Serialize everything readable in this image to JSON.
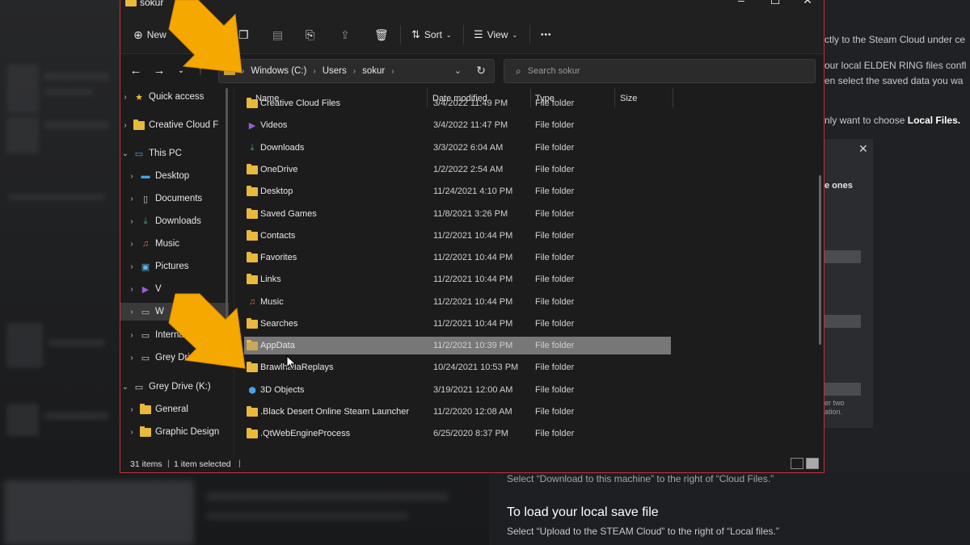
{
  "window": {
    "title": "sokur",
    "controls": [
      "–",
      "☐",
      "✕"
    ]
  },
  "toolbar": {
    "new_label": "New",
    "sort_label": "Sort",
    "view_label": "View",
    "more_label": "•••"
  },
  "address": {
    "segments": [
      "Windows (C:)",
      "Users",
      "sokur"
    ],
    "separator": "›",
    "search_placeholder": "Search sokur"
  },
  "sidebar": {
    "items": [
      {
        "label": "Quick access",
        "icon": "star-icon"
      },
      {
        "label": "Creative Cloud F",
        "icon": "folder-icon"
      },
      {
        "label": "This PC",
        "icon": "monitor-icon"
      },
      {
        "label": "Desktop",
        "icon": "desktop-icon"
      },
      {
        "label": "Documents",
        "icon": "documents-icon"
      },
      {
        "label": "Downloads",
        "icon": "download-icon"
      },
      {
        "label": "Music",
        "icon": "music-icon"
      },
      {
        "label": "Pictures",
        "icon": "pictures-icon"
      },
      {
        "label": "V",
        "icon": "videos-icon"
      },
      {
        "label": "W",
        "icon": "drive-icon"
      },
      {
        "label": "Internal",
        "icon": "drive-icon"
      },
      {
        "label": "Grey Drive (K:)",
        "icon": "drive-icon"
      },
      {
        "label": "Grey Drive (K:)",
        "icon": "drive-icon"
      },
      {
        "label": "General",
        "icon": "folder-icon"
      },
      {
        "label": "Graphic Design",
        "icon": "folder-icon"
      }
    ]
  },
  "columns": {
    "name": "Name",
    "date": "Date modified",
    "type": "Type",
    "size": "Size"
  },
  "files": [
    {
      "name": "Creative Cloud Files",
      "date": "3/4/2022 11:49 PM",
      "type": "File folder",
      "icon": "cloud-folder-icon"
    },
    {
      "name": "Videos",
      "date": "3/4/2022 11:47 PM",
      "type": "File folder",
      "icon": "videos-icon"
    },
    {
      "name": "Downloads",
      "date": "3/3/2022 6:04 AM",
      "type": "File folder",
      "icon": "download-icon"
    },
    {
      "name": "OneDrive",
      "date": "1/2/2022 2:54 AM",
      "type": "File folder",
      "icon": "folder-icon"
    },
    {
      "name": "Desktop",
      "date": "11/24/2021 4:10 PM",
      "type": "File folder",
      "icon": "folder-icon"
    },
    {
      "name": "Saved Games",
      "date": "11/8/2021 3:26 PM",
      "type": "File folder",
      "icon": "folder-icon"
    },
    {
      "name": "Contacts",
      "date": "11/2/2021 10:44 PM",
      "type": "File folder",
      "icon": "folder-icon"
    },
    {
      "name": "Favorites",
      "date": "11/2/2021 10:44 PM",
      "type": "File folder",
      "icon": "folder-icon"
    },
    {
      "name": "Links",
      "date": "11/2/2021 10:44 PM",
      "type": "File folder",
      "icon": "folder-icon"
    },
    {
      "name": "Music",
      "date": "11/2/2021 10:44 PM",
      "type": "File folder",
      "icon": "music-icon"
    },
    {
      "name": "Searches",
      "date": "11/2/2021 10:44 PM",
      "type": "File folder",
      "icon": "folder-icon"
    },
    {
      "name": "AppData",
      "date": "11/2/2021 10:39 PM",
      "type": "File folder",
      "icon": "folder-icon",
      "selected": true
    },
    {
      "name": "BrawlhallaReplays",
      "date": "10/24/2021 10:53 PM",
      "type": "File folder",
      "icon": "folder-icon"
    },
    {
      "name": "3D Objects",
      "date": "3/19/2021 12:00 AM",
      "type": "File folder",
      "icon": "cube-icon"
    },
    {
      "name": ".Black Desert Online Steam Launcher",
      "date": "11/2/2020 12:08 AM",
      "type": "File folder",
      "icon": "folder-icon"
    },
    {
      "name": ".QtWebEngineProcess",
      "date": "6/25/2020 8:37 PM",
      "type": "File folder",
      "icon": "folder-icon"
    }
  ],
  "status": {
    "count": "31 items",
    "selected": "1 item selected"
  },
  "background_page": {
    "right_lines": [
      "ctly to the Steam Cloud under ce",
      "our local ELDEN RING files confl",
      "en select the saved data you wa",
      "nly want to choose"
    ],
    "right_bold": "Local Files.",
    "panel_close": "✕",
    "panel_text": "e ones",
    "panel_note": [
      "er two",
      "ation."
    ],
    "bottom_line1": "Select “Download to this machine” to the right of “Cloud Files.”",
    "bottom_title": "To load your local save file",
    "bottom_line2": "Select “Upload to the STEAM Cloud” to the right of “Local files.”"
  },
  "colors": {
    "window_border": "#c4313b",
    "folder": "#e8b93c",
    "arrow": "#f5a800",
    "selection": "#777777"
  }
}
